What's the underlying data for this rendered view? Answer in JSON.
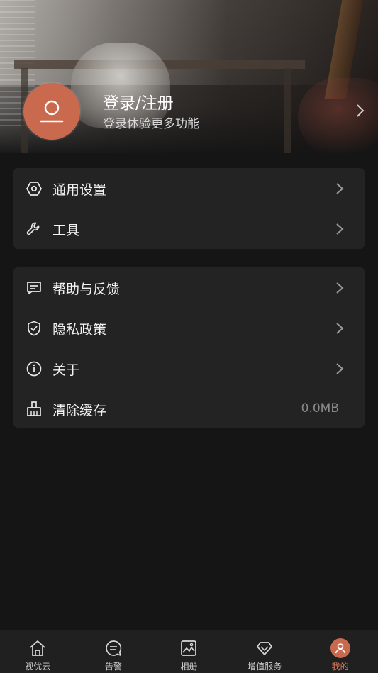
{
  "profile": {
    "title": "登录/注册",
    "subtitle": "登录体验更多功能",
    "avatar_icon": "user-icon",
    "accent_color": "#c96a4f"
  },
  "settings_group": {
    "items": [
      {
        "label": "通用设置",
        "icon": "settings-hexagon-icon"
      },
      {
        "label": "工具",
        "icon": "wrench-icon"
      }
    ]
  },
  "support_group": {
    "items": [
      {
        "label": "帮助与反馈",
        "icon": "feedback-icon"
      },
      {
        "label": "隐私政策",
        "icon": "shield-check-icon"
      },
      {
        "label": "关于",
        "icon": "info-icon"
      },
      {
        "label": "清除缓存",
        "icon": "broom-icon",
        "value": "0.0MB"
      }
    ]
  },
  "tabbar": {
    "tabs": [
      {
        "label": "视优云",
        "icon": "home-icon"
      },
      {
        "label": "告警",
        "icon": "alert-chat-icon"
      },
      {
        "label": "相册",
        "icon": "album-icon"
      },
      {
        "label": "增值服务",
        "icon": "diamond-icon"
      },
      {
        "label": "我的",
        "icon": "profile-icon",
        "active": true
      }
    ],
    "active_color": "#e07a5a"
  }
}
